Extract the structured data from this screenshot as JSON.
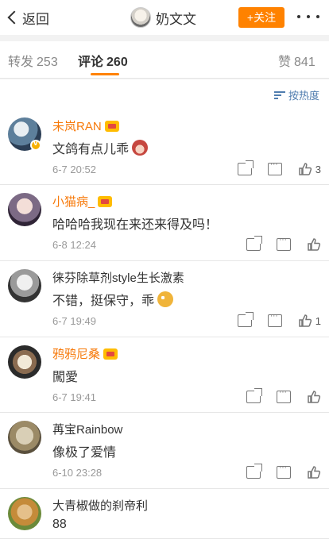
{
  "nav": {
    "back_label": "返回",
    "title": "奶文文",
    "follow_label": "+关注"
  },
  "tabs": [
    {
      "label": "转发",
      "count": "253"
    },
    {
      "label": "评论",
      "count": "260"
    },
    {
      "label": "赞",
      "count": "841"
    }
  ],
  "sort": {
    "label": "按热度"
  },
  "comments": [
    {
      "user": "未岚RAN",
      "text": "文鸽有点儿乖",
      "time": "6-7 20:52",
      "likes": "3",
      "vip": true,
      "verified": true,
      "emoji": "monkey-emoji"
    },
    {
      "user": "小猫病_",
      "text": "哈哈哈我现在来还来得及吗！",
      "time": "6-8 12:24",
      "likes": "",
      "vip": true,
      "verified": false,
      "emoji": ""
    },
    {
      "user": "徕芬除草剂style生长激素",
      "text": "不错，挺保守，乖",
      "time": "6-7 19:49",
      "likes": "1",
      "vip": false,
      "verified": false,
      "emoji": "kiss-emoji"
    },
    {
      "user": "鸦鸦尼桑",
      "text": "闖愛",
      "time": "6-7 19:41",
      "likes": "",
      "vip": true,
      "verified": false,
      "emoji": ""
    },
    {
      "user": "苒宝Rainbow",
      "text": "像极了爱情",
      "time": "6-10 23:28",
      "likes": "",
      "vip": false,
      "verified": false,
      "emoji": ""
    },
    {
      "user": "大青椒做的刹帝利",
      "text": "88",
      "time": "",
      "likes": "",
      "vip": false,
      "verified": false,
      "emoji": ""
    }
  ],
  "colors": {
    "accent": "#ff8200",
    "vip_name": "#f77a0b",
    "link": "#507daf"
  }
}
